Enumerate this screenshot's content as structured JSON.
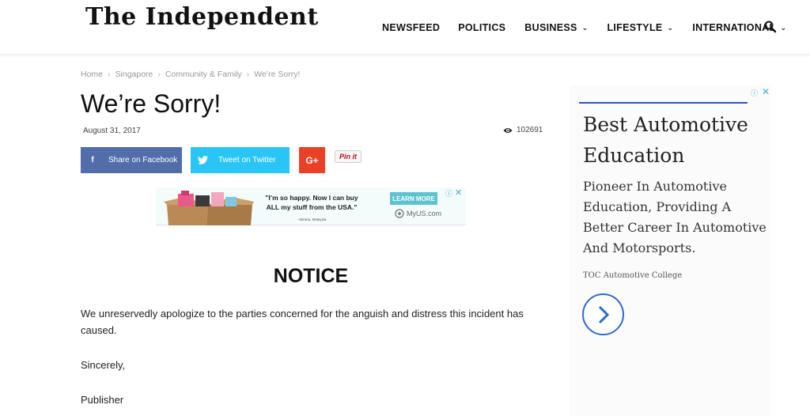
{
  "header": {
    "logo": "The Independent",
    "nav": [
      {
        "label": "NEWSFEED",
        "has_dropdown": false
      },
      {
        "label": "POLITICS",
        "has_dropdown": false
      },
      {
        "label": "BUSINESS",
        "has_dropdown": true
      },
      {
        "label": "LIFESTYLE",
        "has_dropdown": true
      },
      {
        "label": "INTERNATIONAL",
        "has_dropdown": true
      }
    ],
    "search_icon": "search-icon"
  },
  "breadcrumb": [
    "Home",
    "Singapore",
    "Community & Family",
    "We’re Sorry!"
  ],
  "article": {
    "title": "We’re Sorry!",
    "date": "August 31, 2017",
    "views": "102691"
  },
  "share": {
    "facebook": "Share on Facebook",
    "twitter": "Tweet on Twitter",
    "googleplus": "G+",
    "pinterest": "Pin it"
  },
  "banner_ad": {
    "quote": "\"I’m so happy. Now I can buy ALL my stuff from the USA.\"",
    "attribution": "- Mirana, Malaysia",
    "cta": "LEARN MORE",
    "brand": "MyUS.com"
  },
  "body": {
    "heading": "NOTICE",
    "paragraph": "We unreservedly apologize to the parties concerned for the anguish and distress this incident has caused.",
    "closing": "Sincerely,",
    "signature": "Publisher"
  },
  "side_ad": {
    "headline": "Best Automotive Education",
    "description": "Pioneer In Automotive Education, Providing A Better Career In Automotive And Motorsports.",
    "advertiser": "TOC Automotive College"
  },
  "colors": {
    "facebook": "#516eab",
    "twitter": "#29c5f6",
    "googleplus": "#eb4026",
    "ad_accent": "#2a56b5"
  }
}
